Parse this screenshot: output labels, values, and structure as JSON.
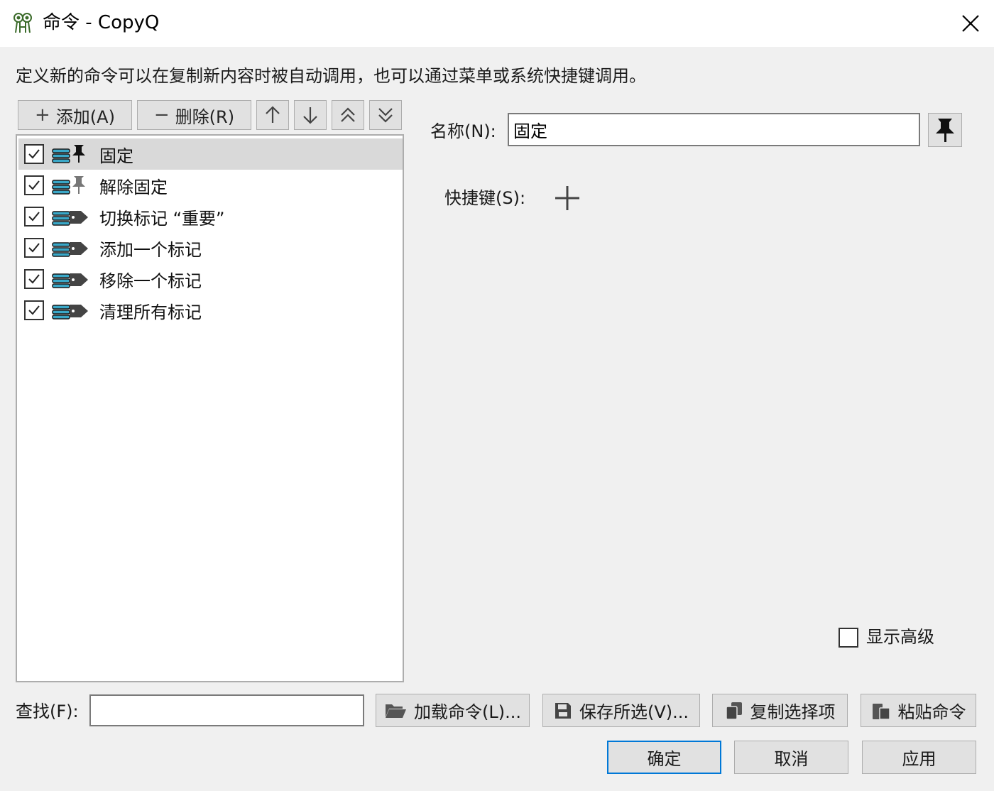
{
  "window": {
    "title": "命令 - CopyQ"
  },
  "description": "定义新的命令可以在复制新内容时被自动调用，也可以通过菜单或系统快捷键调用。",
  "toolbar": {
    "add_label": "添加(A)",
    "remove_label": "删除(R)"
  },
  "commands": [
    {
      "label": "固定",
      "checked": true,
      "icon": "pin-icon",
      "selected": true
    },
    {
      "label": "解除固定",
      "checked": true,
      "icon": "unpin-icon",
      "selected": false
    },
    {
      "label": "切换标记 “重要”",
      "checked": true,
      "icon": "tag-icon",
      "selected": false
    },
    {
      "label": "添加一个标记",
      "checked": true,
      "icon": "tag-icon",
      "selected": false
    },
    {
      "label": "移除一个标记",
      "checked": true,
      "icon": "tag-icon",
      "selected": false
    },
    {
      "label": "清理所有标记",
      "checked": true,
      "icon": "tag-icon",
      "selected": false
    }
  ],
  "editor": {
    "name_label": "名称(N):",
    "name_value": "固定",
    "shortcut_label": "快捷键(S):",
    "advanced_label": "显示高级",
    "advanced_checked": false
  },
  "bottom": {
    "find_label": "查找(F):",
    "find_value": "",
    "load_label": "加载命令(L)...",
    "save_label": "保存所选(V)...",
    "copy_label": "复制选择项",
    "paste_label": "粘贴命令"
  },
  "dialog": {
    "ok_label": "确定",
    "cancel_label": "取消",
    "apply_label": "应用"
  },
  "colors": {
    "accent": "#0078d7",
    "list_icon": "#3aa8c8",
    "selection": "#d9d9d9"
  }
}
